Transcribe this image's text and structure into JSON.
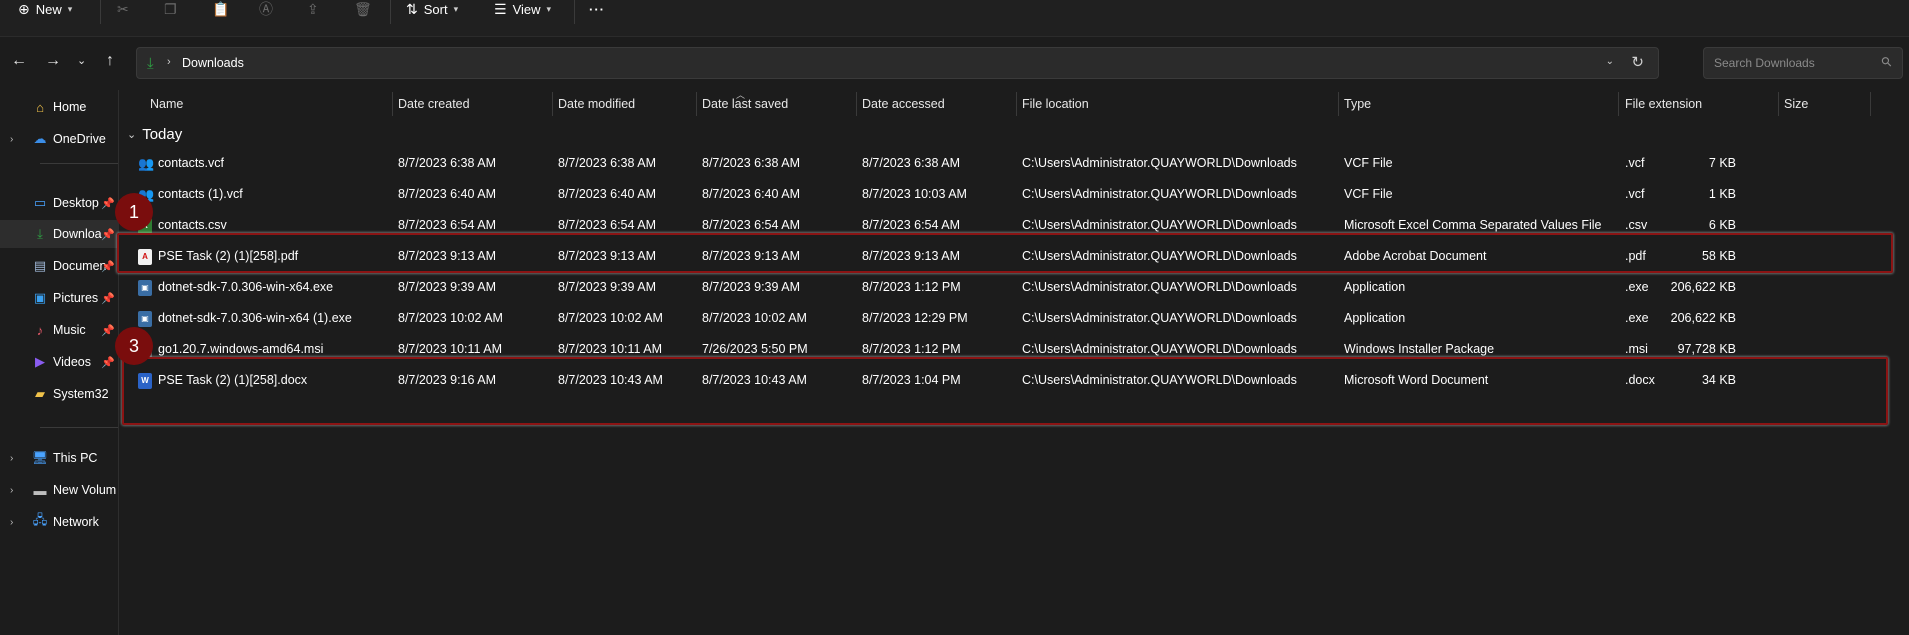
{
  "toolbar": {
    "new_label": "New",
    "sort_label": "Sort",
    "view_label": "View",
    "more_label": "···"
  },
  "address": {
    "path": "Downloads",
    "search_placeholder": "Search Downloads"
  },
  "sidebar": {
    "items": [
      {
        "label": "Home",
        "icon": "home-icon"
      },
      {
        "label": "OneDrive",
        "icon": "cloud-icon"
      },
      {
        "label": "Desktop",
        "icon": "desktop-icon"
      },
      {
        "label": "Downloa",
        "icon": "download-icon"
      },
      {
        "label": "Documen",
        "icon": "document-icon"
      },
      {
        "label": "Pictures",
        "icon": "pictures-icon"
      },
      {
        "label": "Music",
        "icon": "music-icon"
      },
      {
        "label": "Videos",
        "icon": "videos-icon"
      },
      {
        "label": "System32",
        "icon": "folder-icon"
      },
      {
        "label": "This PC",
        "icon": "pc-icon"
      },
      {
        "label": "New Volum",
        "icon": "drive-icon"
      },
      {
        "label": "Network",
        "icon": "network-icon"
      }
    ]
  },
  "columns": [
    "Name",
    "Date created",
    "Date modified",
    "Date last saved",
    "Date accessed",
    "File location",
    "Type",
    "File extension",
    "Size"
  ],
  "group_label": "Today",
  "files": [
    {
      "name": "contacts.vcf",
      "created": "8/7/2023 6:38 AM",
      "modified": "8/7/2023 6:38 AM",
      "saved": "8/7/2023 6:38 AM",
      "accessed": "8/7/2023 6:38 AM",
      "location": "C:\\Users\\Administrator.QUAYWORLD\\Downloads",
      "type": "VCF File",
      "ext": ".vcf",
      "size": "7 KB"
    },
    {
      "name": "contacts (1).vcf",
      "created": "8/7/2023 6:40 AM",
      "modified": "8/7/2023 6:40 AM",
      "saved": "8/7/2023 6:40 AM",
      "accessed": "8/7/2023 10:03 AM",
      "location": "C:\\Users\\Administrator.QUAYWORLD\\Downloads",
      "type": "VCF File",
      "ext": ".vcf",
      "size": "1 KB"
    },
    {
      "name": "contacts.csv",
      "created": "8/7/2023 6:54 AM",
      "modified": "8/7/2023 6:54 AM",
      "saved": "8/7/2023 6:54 AM",
      "accessed": "8/7/2023 6:54 AM",
      "location": "C:\\Users\\Administrator.QUAYWORLD\\Downloads",
      "type": "Microsoft Excel Comma Separated Values File",
      "ext": ".csv",
      "size": "6 KB"
    },
    {
      "name": "PSE Task (2) (1)[258].pdf",
      "created": "8/7/2023 9:13 AM",
      "modified": "8/7/2023 9:13 AM",
      "saved": "8/7/2023 9:13 AM",
      "accessed": "8/7/2023 9:13 AM",
      "location": "C:\\Users\\Administrator.QUAYWORLD\\Downloads",
      "type": "Adobe Acrobat Document",
      "ext": ".pdf",
      "size": "58 KB"
    },
    {
      "name": "dotnet-sdk-7.0.306-win-x64.exe",
      "created": "8/7/2023 9:39 AM",
      "modified": "8/7/2023 9:39 AM",
      "saved": "8/7/2023 9:39 AM",
      "accessed": "8/7/2023 1:12 PM",
      "location": "C:\\Users\\Administrator.QUAYWORLD\\Downloads",
      "type": "Application",
      "ext": ".exe",
      "size": "206,622 KB"
    },
    {
      "name": "dotnet-sdk-7.0.306-win-x64 (1).exe",
      "created": "8/7/2023 10:02 AM",
      "modified": "8/7/2023 10:02 AM",
      "saved": "8/7/2023 10:02 AM",
      "accessed": "8/7/2023 12:29 PM",
      "location": "C:\\Users\\Administrator.QUAYWORLD\\Downloads",
      "type": "Application",
      "ext": ".exe",
      "size": "206,622 KB"
    },
    {
      "name": "go1.20.7.windows-amd64.msi",
      "created": "8/7/2023 10:11 AM",
      "modified": "8/7/2023 10:11 AM",
      "saved": "7/26/2023 5:50 PM",
      "accessed": "8/7/2023 1:12 PM",
      "location": "C:\\Users\\Administrator.QUAYWORLD\\Downloads",
      "type": "Windows Installer Package",
      "ext": ".msi",
      "size": "97,728 KB"
    },
    {
      "name": "PSE Task (2) (1)[258].docx",
      "created": "8/7/2023 9:16 AM",
      "modified": "8/7/2023 10:43 AM",
      "saved": "8/7/2023 10:43 AM",
      "accessed": "8/7/2023 1:04 PM",
      "location": "C:\\Users\\Administrator.QUAYWORLD\\Downloads",
      "type": "Microsoft Word Document",
      "ext": ".docx",
      "size": "34 KB"
    }
  ],
  "annotations": [
    {
      "label": "1"
    },
    {
      "label": "3"
    }
  ]
}
